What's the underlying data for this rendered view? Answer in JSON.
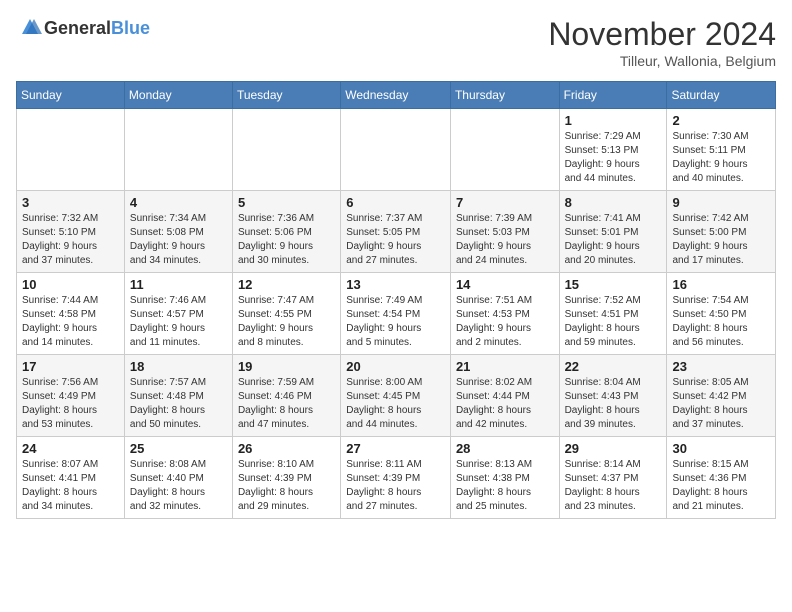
{
  "logo": {
    "text_general": "General",
    "text_blue": "Blue"
  },
  "title": {
    "month_year": "November 2024",
    "location": "Tilleur, Wallonia, Belgium"
  },
  "days_of_week": [
    "Sunday",
    "Monday",
    "Tuesday",
    "Wednesday",
    "Thursday",
    "Friday",
    "Saturday"
  ],
  "weeks": [
    [
      {
        "day": "",
        "info": ""
      },
      {
        "day": "",
        "info": ""
      },
      {
        "day": "",
        "info": ""
      },
      {
        "day": "",
        "info": ""
      },
      {
        "day": "",
        "info": ""
      },
      {
        "day": "1",
        "info": "Sunrise: 7:29 AM\nSunset: 5:13 PM\nDaylight: 9 hours\nand 44 minutes."
      },
      {
        "day": "2",
        "info": "Sunrise: 7:30 AM\nSunset: 5:11 PM\nDaylight: 9 hours\nand 40 minutes."
      }
    ],
    [
      {
        "day": "3",
        "info": "Sunrise: 7:32 AM\nSunset: 5:10 PM\nDaylight: 9 hours\nand 37 minutes."
      },
      {
        "day": "4",
        "info": "Sunrise: 7:34 AM\nSunset: 5:08 PM\nDaylight: 9 hours\nand 34 minutes."
      },
      {
        "day": "5",
        "info": "Sunrise: 7:36 AM\nSunset: 5:06 PM\nDaylight: 9 hours\nand 30 minutes."
      },
      {
        "day": "6",
        "info": "Sunrise: 7:37 AM\nSunset: 5:05 PM\nDaylight: 9 hours\nand 27 minutes."
      },
      {
        "day": "7",
        "info": "Sunrise: 7:39 AM\nSunset: 5:03 PM\nDaylight: 9 hours\nand 24 minutes."
      },
      {
        "day": "8",
        "info": "Sunrise: 7:41 AM\nSunset: 5:01 PM\nDaylight: 9 hours\nand 20 minutes."
      },
      {
        "day": "9",
        "info": "Sunrise: 7:42 AM\nSunset: 5:00 PM\nDaylight: 9 hours\nand 17 minutes."
      }
    ],
    [
      {
        "day": "10",
        "info": "Sunrise: 7:44 AM\nSunset: 4:58 PM\nDaylight: 9 hours\nand 14 minutes."
      },
      {
        "day": "11",
        "info": "Sunrise: 7:46 AM\nSunset: 4:57 PM\nDaylight: 9 hours\nand 11 minutes."
      },
      {
        "day": "12",
        "info": "Sunrise: 7:47 AM\nSunset: 4:55 PM\nDaylight: 9 hours\nand 8 minutes."
      },
      {
        "day": "13",
        "info": "Sunrise: 7:49 AM\nSunset: 4:54 PM\nDaylight: 9 hours\nand 5 minutes."
      },
      {
        "day": "14",
        "info": "Sunrise: 7:51 AM\nSunset: 4:53 PM\nDaylight: 9 hours\nand 2 minutes."
      },
      {
        "day": "15",
        "info": "Sunrise: 7:52 AM\nSunset: 4:51 PM\nDaylight: 8 hours\nand 59 minutes."
      },
      {
        "day": "16",
        "info": "Sunrise: 7:54 AM\nSunset: 4:50 PM\nDaylight: 8 hours\nand 56 minutes."
      }
    ],
    [
      {
        "day": "17",
        "info": "Sunrise: 7:56 AM\nSunset: 4:49 PM\nDaylight: 8 hours\nand 53 minutes."
      },
      {
        "day": "18",
        "info": "Sunrise: 7:57 AM\nSunset: 4:48 PM\nDaylight: 8 hours\nand 50 minutes."
      },
      {
        "day": "19",
        "info": "Sunrise: 7:59 AM\nSunset: 4:46 PM\nDaylight: 8 hours\nand 47 minutes."
      },
      {
        "day": "20",
        "info": "Sunrise: 8:00 AM\nSunset: 4:45 PM\nDaylight: 8 hours\nand 44 minutes."
      },
      {
        "day": "21",
        "info": "Sunrise: 8:02 AM\nSunset: 4:44 PM\nDaylight: 8 hours\nand 42 minutes."
      },
      {
        "day": "22",
        "info": "Sunrise: 8:04 AM\nSunset: 4:43 PM\nDaylight: 8 hours\nand 39 minutes."
      },
      {
        "day": "23",
        "info": "Sunrise: 8:05 AM\nSunset: 4:42 PM\nDaylight: 8 hours\nand 37 minutes."
      }
    ],
    [
      {
        "day": "24",
        "info": "Sunrise: 8:07 AM\nSunset: 4:41 PM\nDaylight: 8 hours\nand 34 minutes."
      },
      {
        "day": "25",
        "info": "Sunrise: 8:08 AM\nSunset: 4:40 PM\nDaylight: 8 hours\nand 32 minutes."
      },
      {
        "day": "26",
        "info": "Sunrise: 8:10 AM\nSunset: 4:39 PM\nDaylight: 8 hours\nand 29 minutes."
      },
      {
        "day": "27",
        "info": "Sunrise: 8:11 AM\nSunset: 4:39 PM\nDaylight: 8 hours\nand 27 minutes."
      },
      {
        "day": "28",
        "info": "Sunrise: 8:13 AM\nSunset: 4:38 PM\nDaylight: 8 hours\nand 25 minutes."
      },
      {
        "day": "29",
        "info": "Sunrise: 8:14 AM\nSunset: 4:37 PM\nDaylight: 8 hours\nand 23 minutes."
      },
      {
        "day": "30",
        "info": "Sunrise: 8:15 AM\nSunset: 4:36 PM\nDaylight: 8 hours\nand 21 minutes."
      }
    ]
  ]
}
